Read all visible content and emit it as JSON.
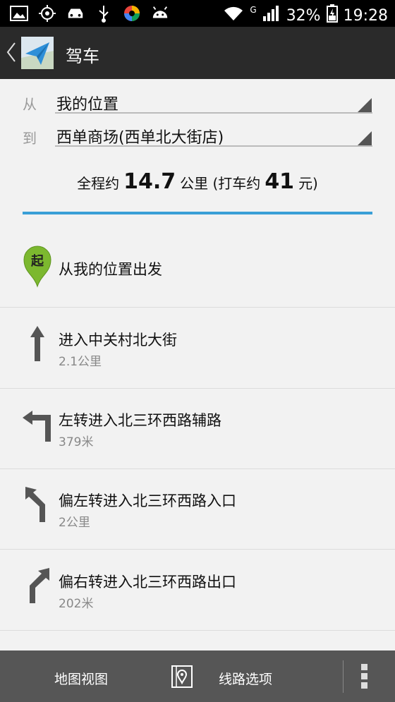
{
  "status_bar": {
    "icons": [
      "image-icon",
      "gps-icon",
      "car-icon",
      "usb-icon",
      "browser-icon",
      "android-icon",
      "wifi-icon",
      "signal-icon",
      "battery-icon"
    ],
    "network": "G",
    "battery": "32%",
    "time": "19:28"
  },
  "action_bar": {
    "title": "驾车"
  },
  "form": {
    "from_label": "从",
    "from_value": "我的位置",
    "to_label": "到",
    "to_value": "西单商场(西单北大街店)"
  },
  "summary": {
    "prefix": "全程约",
    "distance": "14.7",
    "unit": "公里 (打车约",
    "fare": "41",
    "currency": "元)"
  },
  "start": {
    "label": "从我的位置出发",
    "marker": "起"
  },
  "steps": [
    {
      "icon": "arrow-straight-icon",
      "main": "进入中关村北大街",
      "sub": "2.1公里"
    },
    {
      "icon": "turn-left-icon",
      "main": "左转进入北三环西路辅路",
      "sub": "379米"
    },
    {
      "icon": "bear-left-icon",
      "main": "偏左转进入北三环西路入口",
      "sub": "2公里"
    },
    {
      "icon": "bear-right-icon",
      "main": "偏右转进入北三环西路出口",
      "sub": "202米"
    }
  ],
  "bottom_bar": {
    "map_view_label": "地图视图",
    "route_options_label": "线路选项"
  },
  "colors": {
    "accent": "#3a9fd6",
    "start_marker": "#7cb82f",
    "bottom_bar": "#565656",
    "action_bar": "#2a2a2a"
  }
}
